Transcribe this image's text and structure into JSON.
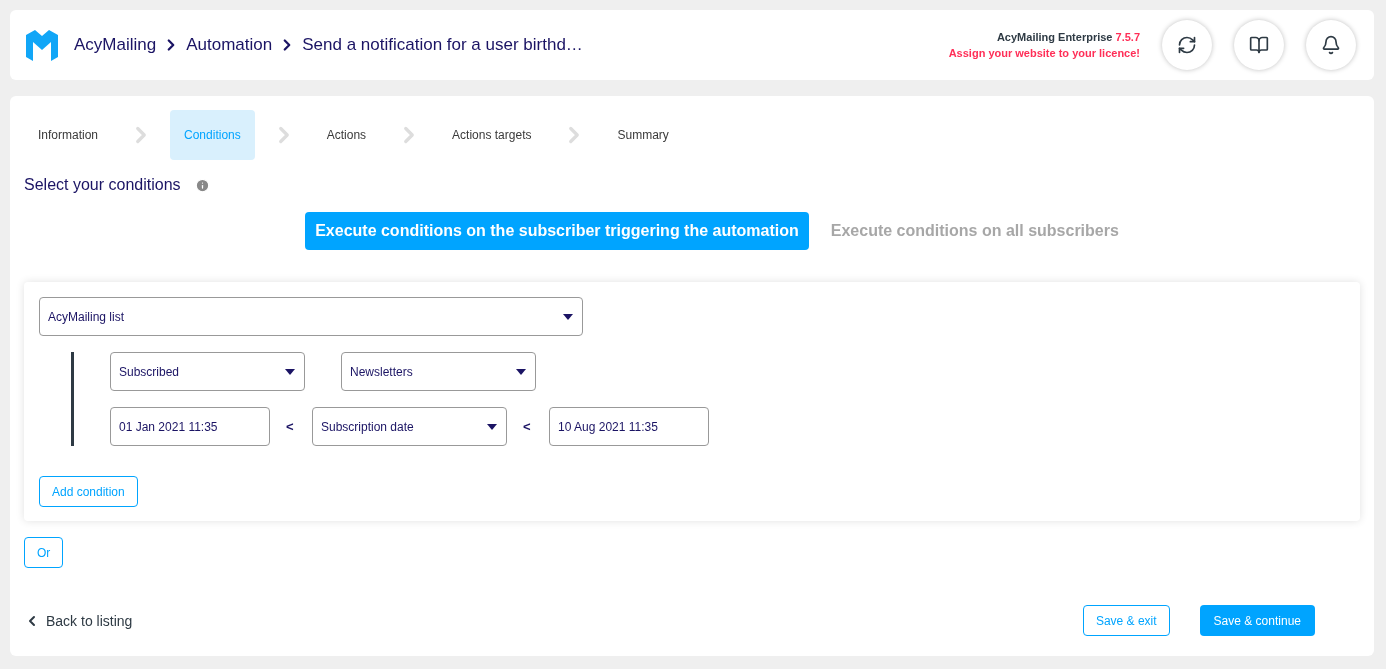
{
  "breadcrumb": [
    "AcyMailing",
    "Automation",
    "Send a notification for a user birthd…"
  ],
  "licence": {
    "product": "AcyMailing Enterprise",
    "version": "7.5.7",
    "warning": "Assign your website to your licence!"
  },
  "header_buttons": [
    {
      "kind": "refresh"
    },
    {
      "kind": "book"
    },
    {
      "kind": "bell"
    }
  ],
  "steps": [
    {
      "label": "Information",
      "selected": false
    },
    {
      "label": "Conditions",
      "selected": true
    },
    {
      "label": "Actions",
      "selected": false
    },
    {
      "label": "Actions targets",
      "selected": false
    },
    {
      "label": "Summary",
      "selected": false
    }
  ],
  "section_title": "Select your conditions",
  "modes": [
    {
      "label": "Execute conditions on the subscriber triggering the automation",
      "selected": true
    },
    {
      "label": "Execute conditions on all subscribers",
      "selected": false
    }
  ],
  "condition": {
    "type": "AcyMailing list",
    "status": "Subscribed",
    "list": "Newsletters",
    "range": {
      "from": "01 Jan 2021 11:35",
      "operator_1": "<",
      "field": "Subscription date",
      "operator_2": "<",
      "to": "10 Aug 2021 11:35"
    },
    "add_button": "Add condition"
  },
  "or_button": "Or",
  "footer": {
    "back": "Back to listing",
    "save_exit": "Save & exit",
    "save_continue": "Save & continue"
  }
}
